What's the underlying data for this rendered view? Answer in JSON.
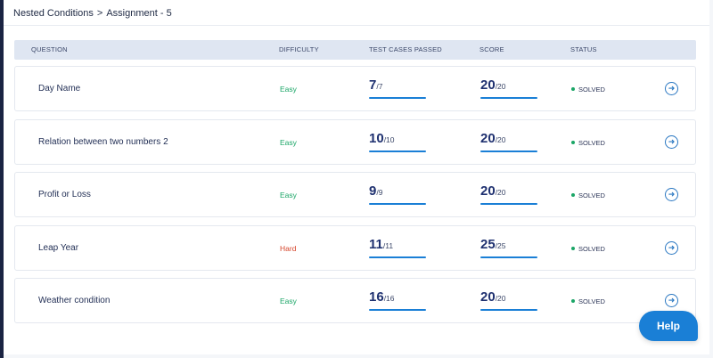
{
  "breadcrumb": {
    "parent": "Nested Conditions",
    "separator": ">",
    "current": "Assignment - 5"
  },
  "table": {
    "headers": [
      "QUESTION",
      "DIFFICULTY",
      "TEST CASES PASSED",
      "SCORE",
      "STATUS"
    ],
    "rows": [
      {
        "question": "Day Name",
        "difficulty": "Easy",
        "passed": "7",
        "total": "/7",
        "score": "20",
        "max": "/20",
        "status": "SOLVED"
      },
      {
        "question": "Relation between two numbers 2",
        "difficulty": "Easy",
        "passed": "10",
        "total": "/10",
        "score": "20",
        "max": "/20",
        "status": "SOLVED"
      },
      {
        "question": "Profit or Loss",
        "difficulty": "Easy",
        "passed": "9",
        "total": "/9",
        "score": "20",
        "max": "/20",
        "status": "SOLVED"
      },
      {
        "question": "Leap Year",
        "difficulty": "Hard",
        "passed": "11",
        "total": "/11",
        "score": "25",
        "max": "/25",
        "status": "SOLVED"
      },
      {
        "question": "Weather condition",
        "difficulty": "Easy",
        "passed": "16",
        "total": "/16",
        "score": "20",
        "max": "/20",
        "status": "SOLVED"
      }
    ]
  },
  "help": {
    "label": "Help"
  },
  "colors": {
    "easy": "#1ba667",
    "hard": "#d6452b",
    "accent": "#1a7fd6",
    "status_dot": "#1ba667"
  },
  "icons": {
    "row_action": "arrow-right-circle-icon"
  }
}
